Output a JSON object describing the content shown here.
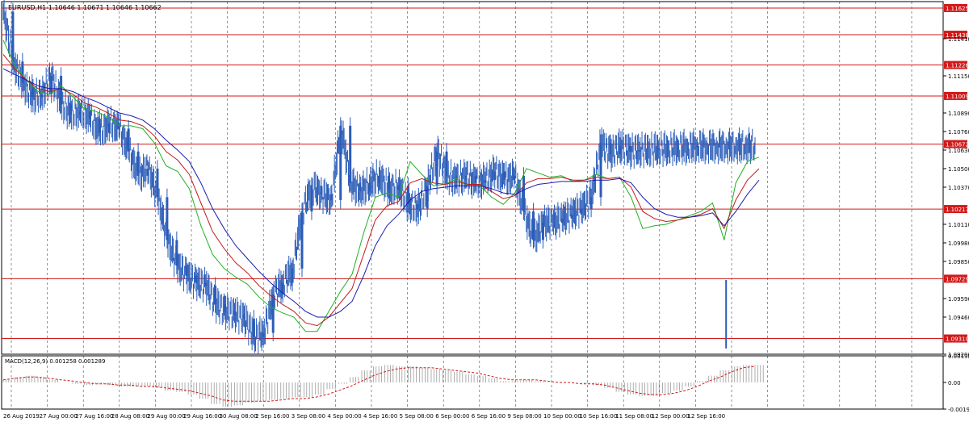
{
  "colors": {
    "background": "#ffffff",
    "frame": "#000000",
    "grid": "#000000",
    "candle": "#2a5cb8",
    "level_line": "#d11a1a",
    "level_tag_bg": "#d11a1a",
    "level_tag_text": "#ffffff",
    "ma_fast": "#22b022",
    "ma_mid": "#c21b1b",
    "ma_slow": "#1b1bb0",
    "macd_hist": "#9a9a9a",
    "macd_signal": "#d11a1a"
  },
  "chart_data": {
    "type": "line",
    "title": "EURUSD,H1  1.10646 1.10671 1.10646 1.10662",
    "symbol": "EURUSD,H1",
    "ohlc_readout": "1.10646 1.10671 1.10646 1.10662",
    "grid": true,
    "ylim": [
      1.092,
      1.1167
    ],
    "y_ticks": [
      "1.11410",
      "1.11150",
      "1.10890",
      "1.10760",
      "1.10630",
      "1.10500",
      "1.10370",
      "1.10110",
      "1.09980",
      "1.09850",
      "1.09590",
      "1.09460",
      "1.09200"
    ],
    "x_ticks": [
      "26 Aug 2019",
      "27 Aug 00:00",
      "27 Aug 16:00",
      "28 Aug 08:00",
      "29 Aug 00:00",
      "29 Aug 16:00",
      "30 Aug 08:00",
      "2 Sep 16:00",
      "3 Sep 08:00",
      "4 Sep 00:00",
      "4 Sep 16:00",
      "5 Sep 08:00",
      "6 Sep 00:00",
      "6 Sep 16:00",
      "9 Sep 08:00",
      "10 Sep 00:00",
      "10 Sep 16:00",
      "11 Sep 08:00",
      "12 Sep 00:00",
      "12 Sep 16:00"
    ],
    "levels": [
      "1.11625",
      "1.11438",
      "1.11226",
      "1.11009",
      "1.10672",
      "1.10217",
      "1.09729",
      "1.09310"
    ],
    "price_series": {
      "name": "EURUSD H1 close",
      "x_index": [
        0,
        12,
        24,
        36,
        48,
        60,
        72,
        84,
        96,
        108,
        120,
        132,
        144,
        156,
        168,
        180,
        192,
        204,
        216,
        228,
        240,
        252,
        264,
        276,
        288,
        300,
        312,
        324,
        336,
        348,
        360,
        372,
        384,
        396,
        408,
        420,
        432,
        444,
        456,
        468,
        480,
        492,
        504,
        516,
        528,
        540,
        552,
        564,
        576,
        588,
        600,
        612,
        624,
        636,
        648,
        660,
        672,
        684,
        696,
        708,
        720,
        732,
        744,
        756,
        768,
        780,
        792,
        804,
        816,
        828,
        840,
        852,
        864,
        876,
        888,
        900,
        912,
        924,
        936
      ],
      "values": [
        1.116,
        1.1125,
        1.111,
        1.11,
        1.1102,
        1.1115,
        1.1095,
        1.1088,
        1.109,
        1.1085,
        1.1075,
        1.1082,
        1.1078,
        1.1062,
        1.1045,
        1.105,
        1.103,
        1.1,
        1.0982,
        1.0975,
        1.097,
        1.0968,
        1.0955,
        1.095,
        1.0948,
        1.0945,
        1.0932,
        1.0935,
        1.0962,
        1.097,
        1.098,
        1.102,
        1.1038,
        1.1032,
        1.1028,
        1.108,
        1.104,
        1.1034,
        1.104,
        1.1045,
        1.1035,
        1.1038,
        1.1025,
        1.1022,
        1.1038,
        1.1062,
        1.1045,
        1.1042,
        1.1045,
        1.104,
        1.1042,
        1.1048,
        1.1042,
        1.1045,
        1.102,
        1.1,
        1.1012,
        1.1012,
        1.1015,
        1.1018,
        1.1022,
        1.103,
        1.1068,
        1.106,
        1.1066,
        1.1062,
        1.1063,
        1.1063,
        1.1064,
        1.1064,
        1.1065,
        1.1065,
        1.1066,
        1.1066,
        1.1066,
        1.1066,
        1.1066,
        1.1066,
        1.1066
      ]
    },
    "series": [
      {
        "name": "",
        "color": "#22b022",
        "values": [
          1.114,
          1.1122,
          1.1112,
          1.1104,
          1.1102,
          1.1108,
          1.11,
          1.1092,
          1.109,
          1.1086,
          1.108,
          1.108,
          1.1078,
          1.1068,
          1.1052,
          1.1048,
          1.1036,
          1.101,
          1.099,
          1.098,
          1.0974,
          1.0969,
          1.096,
          1.0953,
          1.0949,
          1.0946,
          1.0936,
          1.0936,
          1.095,
          1.0964,
          1.0976,
          1.1005,
          1.103,
          1.1033,
          1.103,
          1.1055,
          1.1046,
          1.1038,
          1.1039,
          1.1043,
          1.1038,
          1.1038,
          1.103,
          1.1025,
          1.1033,
          1.105,
          1.1047,
          1.1044,
          1.1045,
          1.1041,
          1.1042,
          1.1046,
          1.1043,
          1.1044,
          1.103,
          1.1008,
          1.101,
          1.1011,
          1.1014,
          1.1017,
          1.102,
          1.1026,
          1.1,
          1.104,
          1.1055,
          1.1058
        ]
      },
      {
        "name": "",
        "color": "#c21b1b",
        "values": [
          1.113,
          1.112,
          1.1112,
          1.1106,
          1.1104,
          1.1106,
          1.1102,
          1.1096,
          1.1093,
          1.1089,
          1.1084,
          1.1083,
          1.108,
          1.1073,
          1.1062,
          1.1056,
          1.1046,
          1.1026,
          1.1006,
          1.0994,
          1.0984,
          1.0977,
          1.0968,
          1.0961,
          1.0955,
          1.095,
          1.0942,
          1.094,
          1.0946,
          1.0956,
          1.0966,
          1.099,
          1.1014,
          1.1024,
          1.1027,
          1.104,
          1.1043,
          1.104,
          1.1039,
          1.1041,
          1.1039,
          1.1039,
          1.1034,
          1.1029,
          1.1031,
          1.104,
          1.1043,
          1.1043,
          1.1044,
          1.1042,
          1.1042,
          1.1044,
          1.1043,
          1.1044,
          1.1037,
          1.102,
          1.1015,
          1.1013,
          1.1014,
          1.1016,
          1.1018,
          1.1022,
          1.1008,
          1.1028,
          1.1042,
          1.105
        ]
      },
      {
        "name": "",
        "color": "#1b1bb0",
        "values": [
          1.112,
          1.1116,
          1.1112,
          1.1108,
          1.1106,
          1.1106,
          1.1104,
          1.11,
          1.1097,
          1.1093,
          1.1089,
          1.1087,
          1.1084,
          1.1078,
          1.107,
          1.1063,
          1.1055,
          1.104,
          1.1022,
          1.1008,
          1.0996,
          1.0987,
          1.0978,
          1.097,
          1.0963,
          1.0957,
          1.095,
          1.0946,
          1.0946,
          1.095,
          1.0957,
          1.0975,
          1.0996,
          1.101,
          1.1018,
          1.1028,
          1.1034,
          1.1036,
          1.1037,
          1.1038,
          1.1038,
          1.1038,
          1.1036,
          1.1033,
          1.1032,
          1.1036,
          1.1039,
          1.104,
          1.1041,
          1.1041,
          1.1041,
          1.1042,
          1.1042,
          1.1043,
          1.104,
          1.103,
          1.1022,
          1.1018,
          1.1016,
          1.1016,
          1.1017,
          1.1019,
          1.101,
          1.102,
          1.1032,
          1.1042
        ]
      }
    ],
    "macd": {
      "label": "MACD(12,26,9) 0.001258 0.001289",
      "ylim": [
        -0.00198,
        0.00198
      ],
      "y_ticks": [
        "0.00198",
        "0.00",
        "-0.00198"
      ],
      "histogram": [
        0.0002,
        0.0004,
        0.0005,
        0.0004,
        0.0002,
        0.0,
        -0.0001,
        -0.0002,
        -0.0001,
        -0.0002,
        -0.0003,
        -0.0003,
        -0.0003,
        -0.0004,
        -0.0006,
        -0.0007,
        -0.0009,
        -0.0012,
        -0.0016,
        -0.0018,
        -0.0017,
        -0.0015,
        -0.0014,
        -0.0013,
        -0.0012,
        -0.0011,
        -0.0011,
        -0.0009,
        -0.0005,
        -0.0001,
        0.0004,
        0.0009,
        0.0012,
        0.0013,
        0.0012,
        0.0012,
        0.0011,
        0.001,
        0.0009,
        0.0008,
        0.0006,
        0.0005,
        0.0003,
        0.0001,
        0.0001,
        0.0002,
        0.0001,
        0.0,
        0.0,
        0.0,
        -0.0001,
        -0.0002,
        -0.0004,
        -0.0007,
        -0.0009,
        -0.001,
        -0.001,
        -0.0008,
        -0.0006,
        -0.0003,
        0.0001,
        0.0005,
        0.0009,
        0.0012,
        0.0013,
        0.0013
      ],
      "signal": [
        0.0002,
        0.0003,
        0.0004,
        0.0004,
        0.0003,
        0.0002,
        0.0001,
        -0.0,
        -0.0001,
        -0.0001,
        -0.0002,
        -0.0002,
        -0.0003,
        -0.0003,
        -0.0004,
        -0.0005,
        -0.0006,
        -0.0008,
        -0.001,
        -0.0013,
        -0.0014,
        -0.0014,
        -0.0014,
        -0.0014,
        -0.0013,
        -0.0012,
        -0.0012,
        -0.0011,
        -0.0009,
        -0.0006,
        -0.0003,
        0.0001,
        0.0005,
        0.0008,
        0.001,
        0.0011,
        0.0011,
        0.0011,
        0.001,
        0.0009,
        0.0008,
        0.0007,
        0.0005,
        0.0003,
        0.0002,
        0.0002,
        0.0002,
        0.0001,
        0.0,
        0.0,
        -0.0001,
        -0.0001,
        -0.0002,
        -0.0004,
        -0.0006,
        -0.0008,
        -0.0009,
        -0.0009,
        -0.0008,
        -0.0006,
        -0.0003,
        0.0001,
        0.0004,
        0.0008,
        0.0011,
        0.0012
      ]
    }
  }
}
